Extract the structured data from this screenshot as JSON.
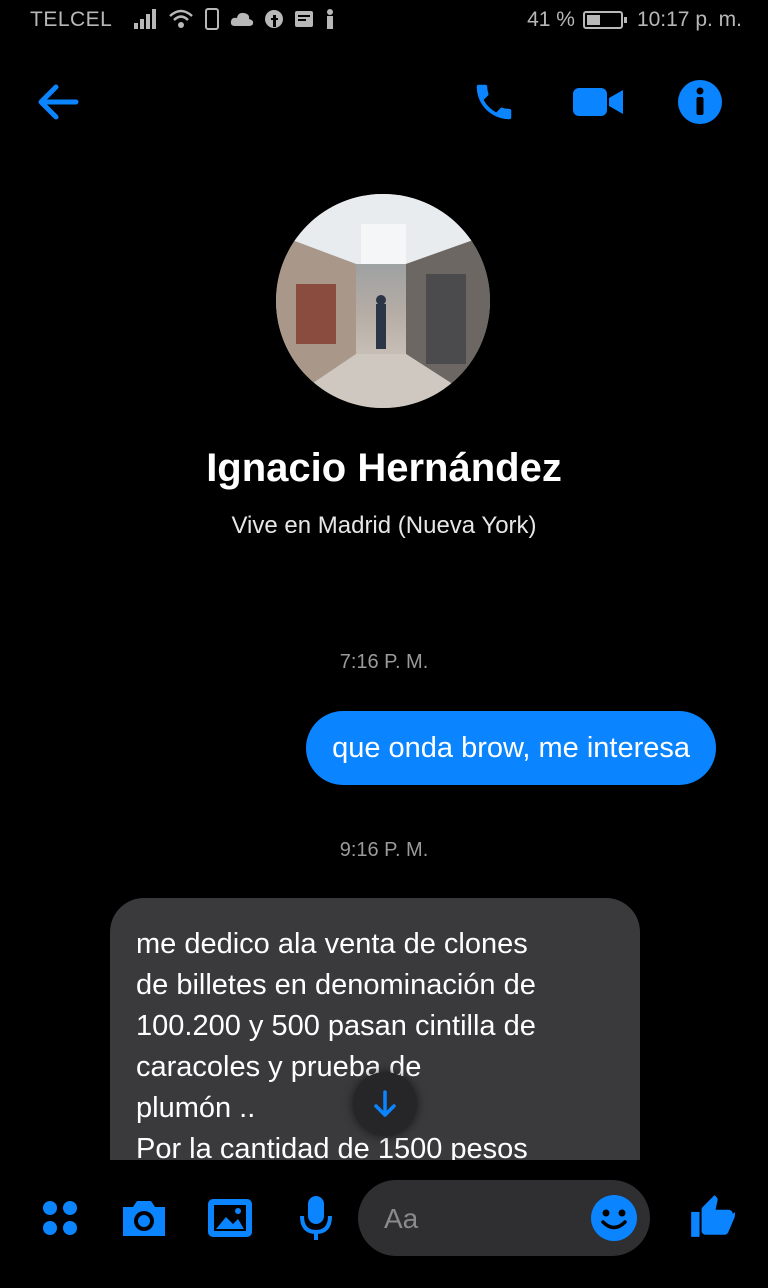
{
  "status_bar": {
    "carrier": "TELCEL",
    "battery_percent_text": "41 %",
    "battery_level": 0.41,
    "time": "10:17 p. m."
  },
  "header": {
    "back_icon": "arrow-left-icon",
    "call_icon": "phone-icon",
    "video_icon": "video-camera-icon",
    "info_icon": "info-icon",
    "accent_color": "#0a84ff"
  },
  "profile": {
    "name": "Ignacio Hernández",
    "subtitle": "Vive en Madrid (Nueva York)"
  },
  "messages": [
    {
      "type": "timestamp",
      "text": "7:16 P. M."
    },
    {
      "type": "outgoing",
      "text": "que onda brow, me interesa"
    },
    {
      "type": "timestamp",
      "text": "9:16 P. M."
    },
    {
      "type": "incoming",
      "lines": [
        "me dedico ala venta de clones",
        "de billetes en denominación de",
        "100.200 y 500 pasan cintilla de",
        "caracoles y prueba de",
        "plumón ..",
        "Por la cantidad de 1500 pesos"
      ]
    }
  ],
  "composer": {
    "placeholder": "Aa",
    "icons": [
      "more-icon",
      "camera-icon",
      "image-icon",
      "microphone-icon",
      "emoji-icon",
      "thumbs-up-icon"
    ]
  },
  "colors": {
    "background": "#000000",
    "outgoing_bubble": "#0a84ff",
    "incoming_bubble": "#3a3a3c"
  }
}
